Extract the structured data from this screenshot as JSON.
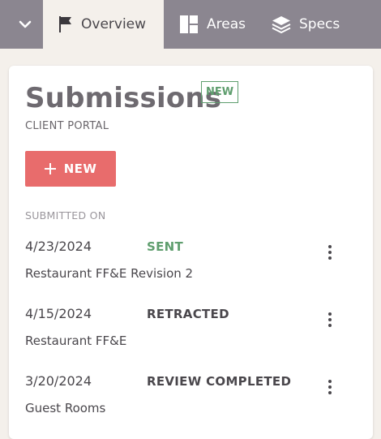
{
  "nav": {
    "tabs": [
      {
        "label": "Overview",
        "icon": "flag-icon",
        "active": true
      },
      {
        "label": "Areas",
        "icon": "layout-icon",
        "active": false
      },
      {
        "label": "Specs",
        "icon": "layers-icon",
        "active": false
      }
    ]
  },
  "card": {
    "title": "Submissions",
    "badge": "NEW",
    "subtitle": "CLIENT PORTAL",
    "new_button_label": "NEW",
    "section_label": "SUBMITTED ON",
    "submissions": [
      {
        "date": "4/23/2024",
        "status": "SENT",
        "status_color": "#5f9e6e",
        "name": "Restaurant FF&E Revision 2"
      },
      {
        "date": "4/15/2024",
        "status": "RETRACTED",
        "status_color": "#4a474c",
        "name": "Restaurant FF&E"
      },
      {
        "date": "3/20/2024",
        "status": "REVIEW COMPLETED",
        "status_color": "#4a474c",
        "name": "Guest Rooms"
      }
    ]
  },
  "colors": {
    "topbar": "#8b8690",
    "accent": "#e86c6c",
    "badge_green": "#5f9e6e"
  }
}
